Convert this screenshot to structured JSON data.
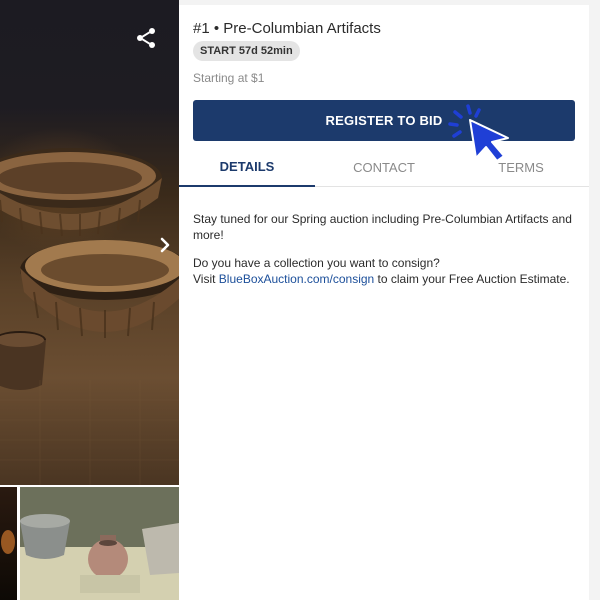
{
  "lot": {
    "title": "#1 • Pre-Columbian Artifacts",
    "start_badge": "START 57d 52min",
    "starting_price": "Starting at $1"
  },
  "actions": {
    "register_label": "REGISTER TO BID"
  },
  "tabs": [
    {
      "label": "DETAILS",
      "active": true
    },
    {
      "label": "CONTACT",
      "active": false
    },
    {
      "label": "TERMS",
      "active": false
    }
  ],
  "details": {
    "paragraph1": "Stay tuned for our Spring auction including Pre-Columbian Artifacts and more!",
    "paragraph2_line1": "Do you have a collection you want to consign?",
    "paragraph2_prefix": "Visit ",
    "consign_link": "BlueBoxAuction.com/consign",
    "paragraph2_suffix": " to claim your Free Auction Estimate."
  },
  "icons": {
    "share": "share-icon",
    "next": "chevron-right-icon",
    "cursor": "click-cursor-icon"
  },
  "colors": {
    "accent": "#1c3a6c",
    "link": "#1c4f9a",
    "cursor": "#1f3fd6"
  }
}
